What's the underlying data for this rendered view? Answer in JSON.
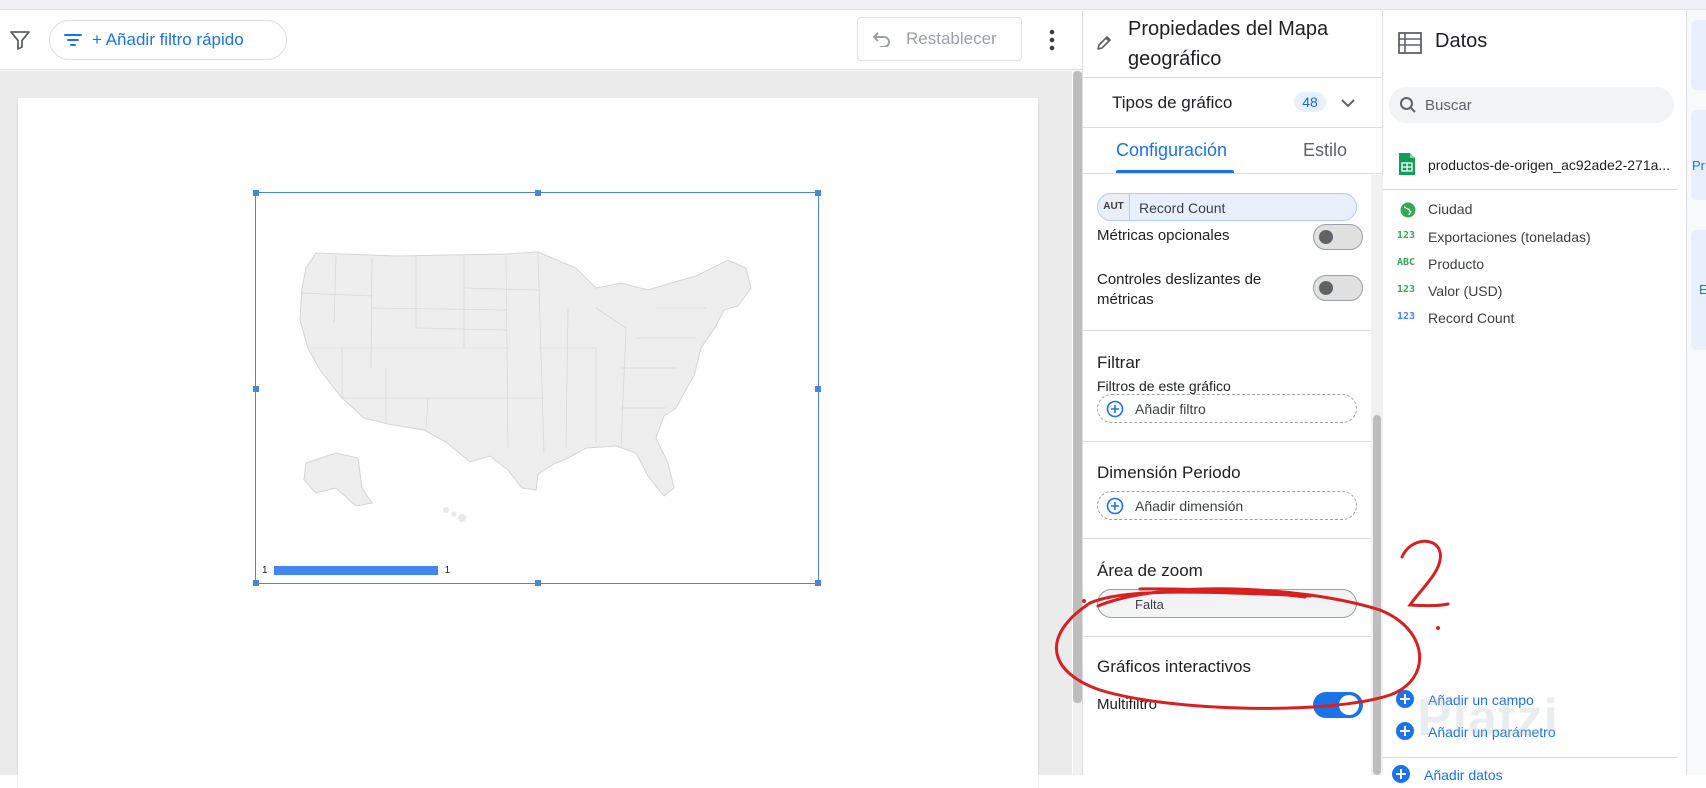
{
  "toolbar": {
    "quick_filter_label": "+ Añadir filtro rápido",
    "reset_label": "Restablecer"
  },
  "chart": {
    "legend_min": "1",
    "legend_max": "1",
    "colors": {
      "legend_bar": "#4285f4",
      "selection": "#4a86d8",
      "map_fill": "#eeeeee"
    }
  },
  "properties": {
    "title": "Propiedades del Mapa geográfico",
    "chart_types_label": "Tipos de gráfico",
    "chart_types_count": "48",
    "tabs": [
      {
        "label": "Configuración",
        "active": true
      },
      {
        "label": "Estilo",
        "active": false
      }
    ],
    "metric_chip": {
      "type": "AUT",
      "name": "Record Count"
    },
    "optional_metrics_label": "Métricas opcionales",
    "optional_metrics_on": false,
    "metric_sliders_label": "Controles deslizantes de métricas",
    "metric_sliders_on": false,
    "filter": {
      "title": "Filtrar",
      "subtitle": "Filtros de este gráfico",
      "add_label": "Añadir filtro"
    },
    "period_dimension": {
      "title": "Dimensión Periodo",
      "add_label": "Añadir dimensión"
    },
    "zoom_area": {
      "title": "Área de zoom",
      "value": "Falta"
    },
    "interactive": {
      "title": "Gráficos interactivos",
      "multifilter_label": "Multifiltro",
      "multifilter_on": true
    }
  },
  "data_panel": {
    "title": "Datos",
    "search_placeholder": "Buscar",
    "source_name": "productos-de-origen_ac92ade2-271a...",
    "fields": [
      {
        "type": "geo",
        "label": "Ciudad",
        "color": "#34a853"
      },
      {
        "type": "123",
        "label": "Exportaciones (toneladas)",
        "color": "#34a853"
      },
      {
        "type": "ABC",
        "label": "Producto",
        "color": "#34a853"
      },
      {
        "type": "123",
        "label": "Valor (USD)",
        "color": "#34a853"
      },
      {
        "type": "123",
        "label": "Record Count",
        "color": "#4285f4"
      }
    ],
    "add_field_label": "Añadir un campo",
    "add_parameter_label": "Añadir un parámetro",
    "add_data_label": "Añadir datos"
  },
  "right_strip": {
    "card_top": "Pr",
    "card_bottom": "E"
  },
  "annotation": {
    "text": "?"
  },
  "watermark": "Platzi"
}
